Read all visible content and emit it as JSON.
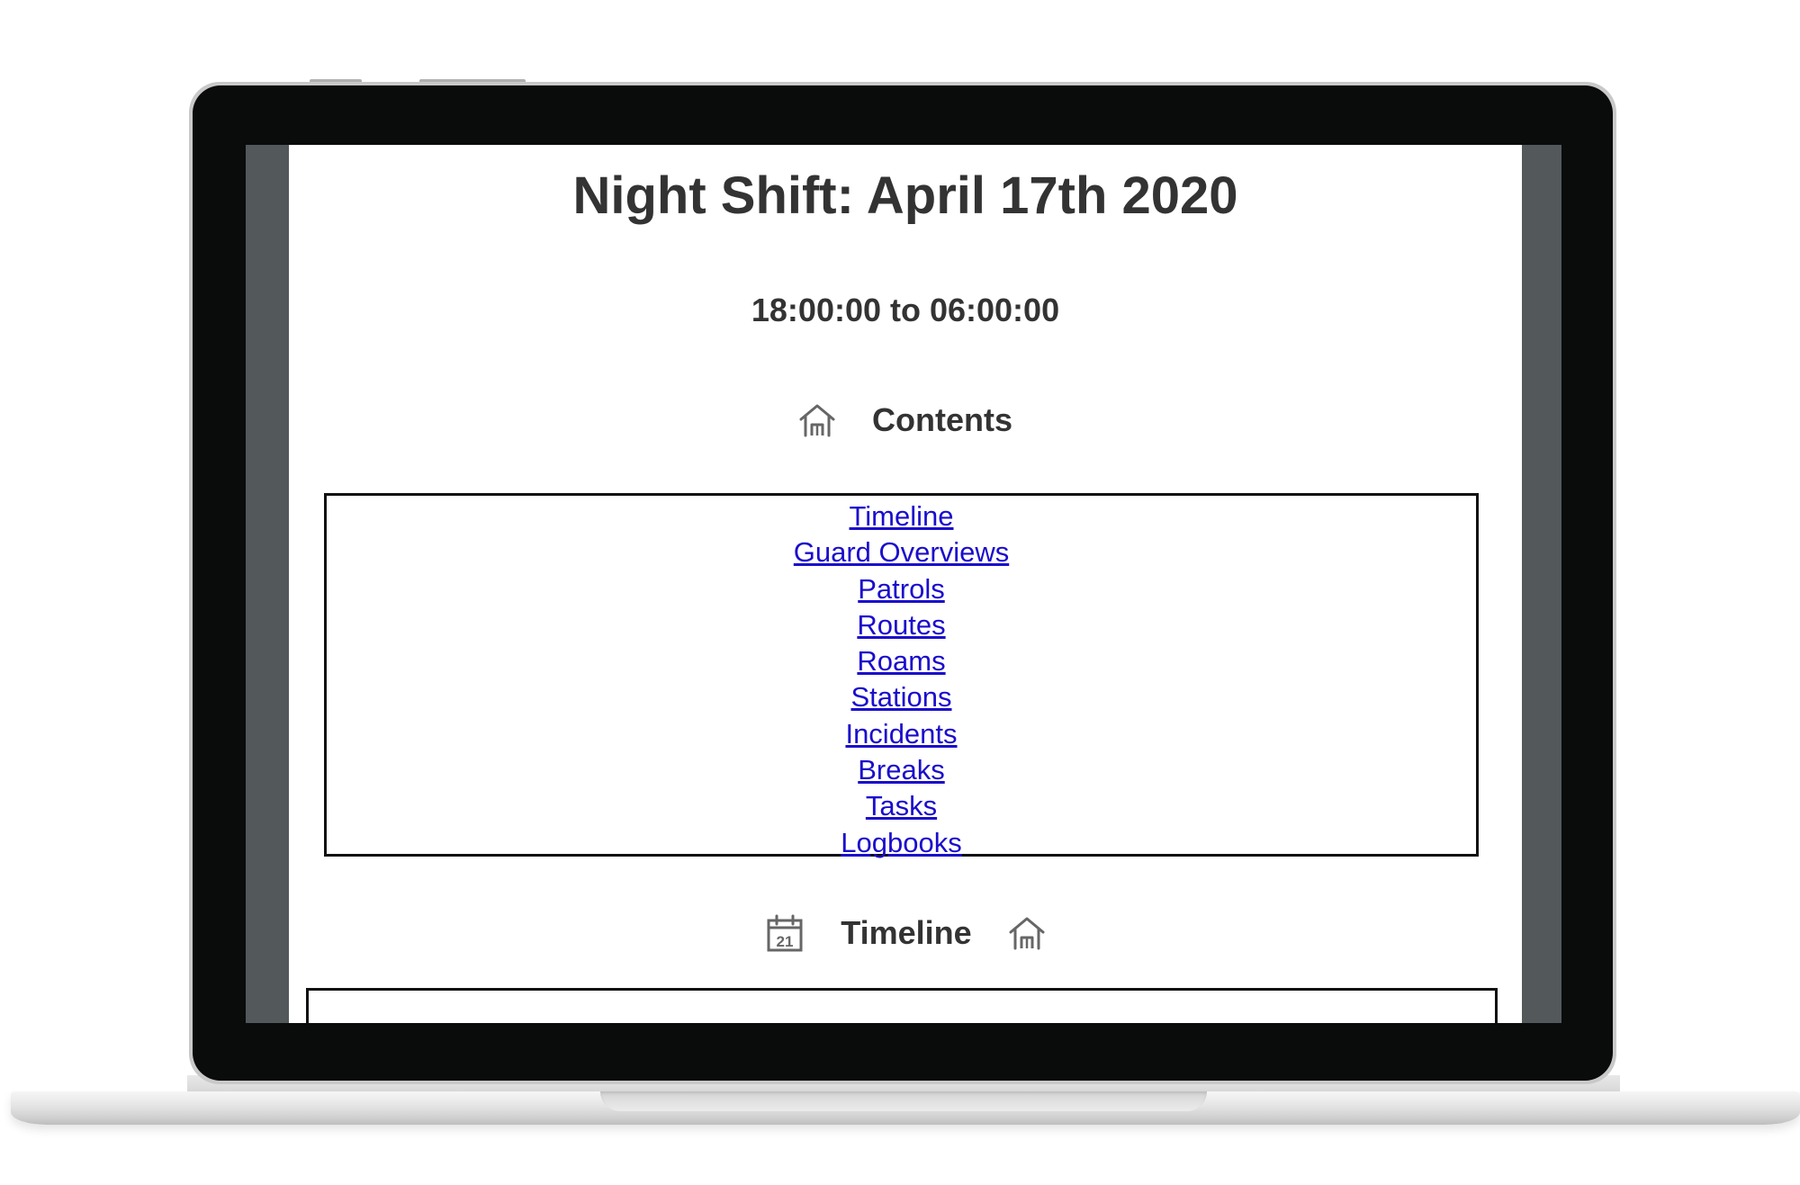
{
  "page": {
    "title": "Night Shift: April 17th 2020",
    "shift_hours": "18:00:00 to 06:00:00"
  },
  "contents": {
    "heading": "Contents",
    "icon": "home-icon",
    "links": [
      "Timeline",
      "Guard Overviews",
      "Patrols",
      "Routes",
      "Roams",
      "Stations",
      "Incidents",
      "Breaks",
      "Tasks",
      "Logbooks"
    ]
  },
  "timeline": {
    "heading": "Timeline",
    "calendar_day": "21",
    "icons": [
      "calendar-icon",
      "home-icon"
    ]
  },
  "colors": {
    "text": "#333333",
    "link": "#1a0dcc",
    "bezel": "#0a0b0b",
    "screen_gutter": "#53585b"
  }
}
